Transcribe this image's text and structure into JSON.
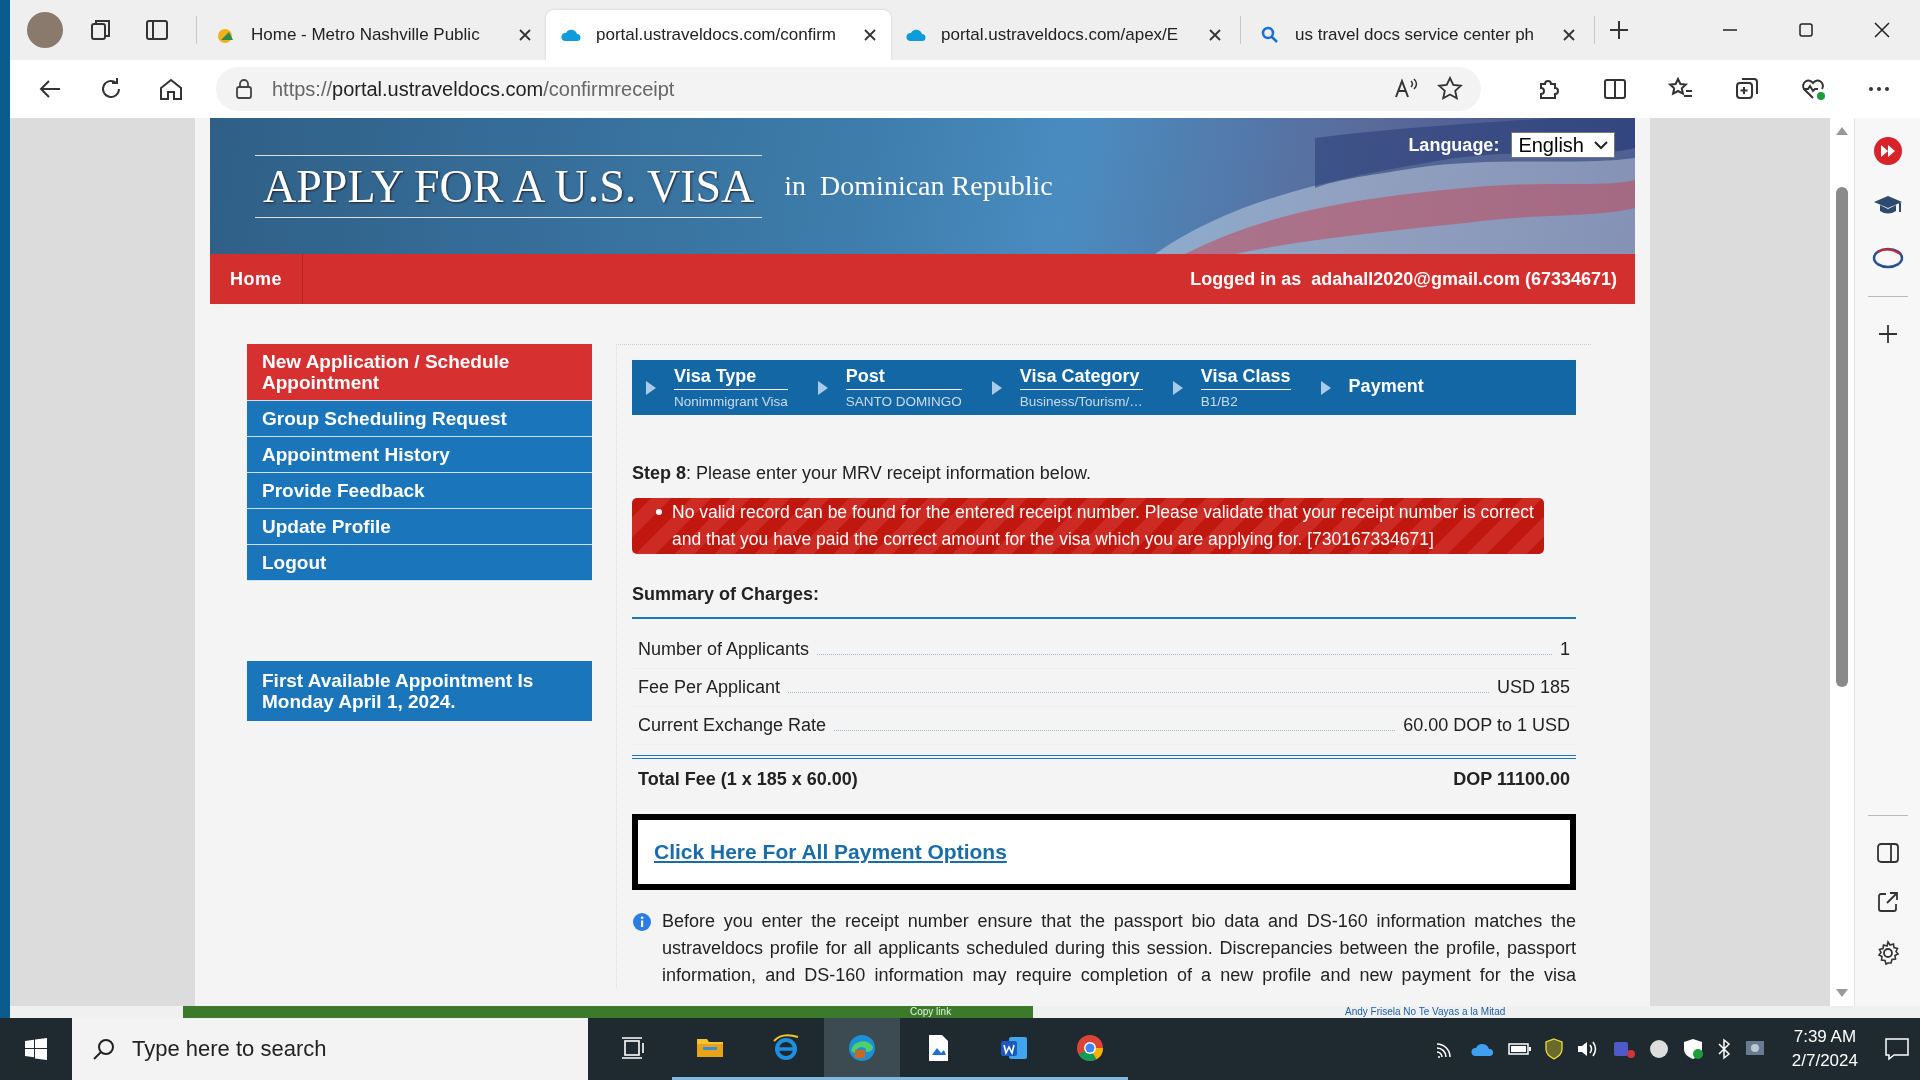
{
  "browser": {
    "tabs": [
      {
        "title": "Home - Metro Nashville Public",
        "kind": "library",
        "selected": false
      },
      {
        "title": "portal.ustraveldocs.com/confirm",
        "kind": "cloud",
        "selected": true
      },
      {
        "title": "portal.ustraveldocs.com/apex/E",
        "kind": "cloud",
        "selected": false
      },
      {
        "title": "us travel docs service center ph",
        "kind": "search",
        "selected": false
      }
    ],
    "address": {
      "scheme": "https://",
      "host": "portal.ustraveldocs.com",
      "path": "/confirmreceipt"
    }
  },
  "banner": {
    "title": "APPLY FOR A U.S. VISA",
    "location": "in  Dominican Republic",
    "language_label": "Language:",
    "language_value": "English"
  },
  "nav": {
    "home": "Home",
    "logged_in": "Logged in as  adahall2020@gmail.com (67334671)"
  },
  "menu": [
    {
      "label": "New Application / Schedule Appointment",
      "selected": true
    },
    {
      "label": "Group Scheduling Request",
      "selected": false
    },
    {
      "label": "Appointment History",
      "selected": false
    },
    {
      "label": "Provide Feedback",
      "selected": false
    },
    {
      "label": "Update Profile",
      "selected": false
    },
    {
      "label": "Logout",
      "selected": false
    }
  ],
  "first_available": "First Available Appointment Is Monday April 1, 2024.",
  "steps": [
    {
      "label": "Visa Type",
      "value": "Nonimmigrant Visa"
    },
    {
      "label": "Post",
      "value": "SANTO DOMINGO"
    },
    {
      "label": "Visa Category",
      "value": "Business/Tourism/…"
    },
    {
      "label": "Visa Class",
      "value": "B1/B2"
    },
    {
      "label": "Payment"
    }
  ],
  "instruction": "**Step 8**: Please enter your MRV receipt information below.",
  "errors": [
    "No valid record can be found for the entered receipt number. Please validate that your receipt number is correct and that you have paid the correct amount for the visa which you are applying for. [730167334671]"
  ],
  "summary": {
    "title": "Summary of Charges:",
    "rows": [
      {
        "label": "Number of Applicants",
        "value": "1"
      },
      {
        "label": "Fee Per Applicant",
        "value": "USD 185"
      },
      {
        "label": "Current Exchange Rate",
        "value": "60.00 DOP to 1 USD"
      }
    ],
    "total_label": "Total Fee (1 x 185 x 60.00)",
    "total_value": "DOP 11100.00"
  },
  "payment_link": "Click Here For All Payment Options",
  "info": "Before you enter the receipt number ensure that the passport bio data and DS-160 information matches the ustraveldocs profile for all applicants scheduled during this session. Discrepancies between the profile, passport information, and DS-160 information may require completion of a new profile and new payment for the visa",
  "background_window": {
    "left": "Copy link",
    "right": "Andy Frisela No Te Vayas a la Mitad"
  },
  "taskbar": {
    "search_placeholder": "Type here to search",
    "apps": [
      {
        "kind": "explorer",
        "selected": false
      },
      {
        "kind": "ie",
        "selected": false
      },
      {
        "kind": "edge",
        "selected": true
      },
      {
        "kind": "paint",
        "selected": false
      },
      {
        "kind": "word",
        "selected": false
      },
      {
        "kind": "chrome",
        "selected": false
      }
    ],
    "time": "7:39 AM",
    "date": "2/7/2024"
  }
}
